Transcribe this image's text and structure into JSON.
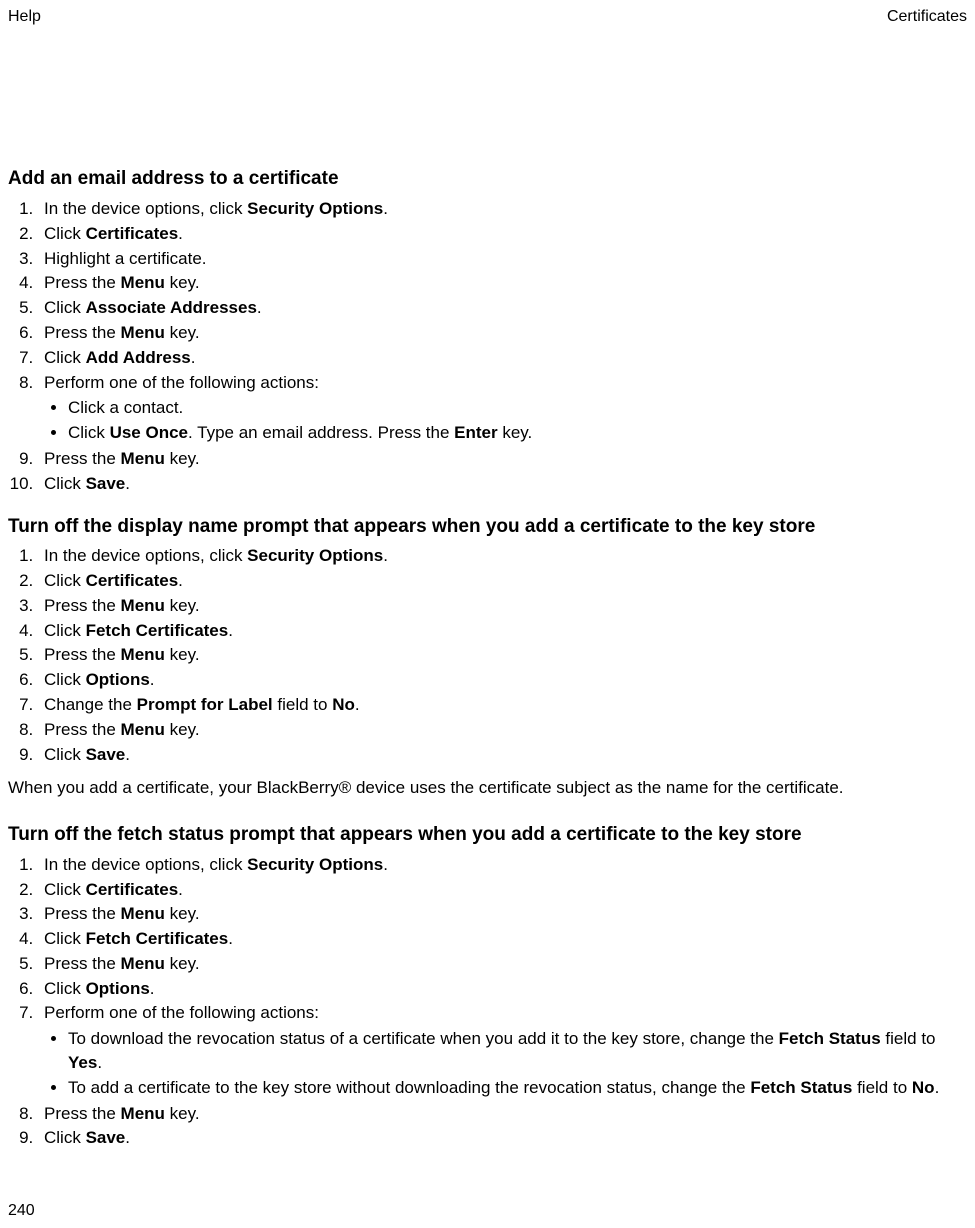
{
  "header": {
    "left": "Help",
    "right": "Certificates"
  },
  "footer": {
    "page": "240"
  },
  "sections": [
    {
      "title": "Add an email address to a certificate",
      "steps": [
        {
          "pre": "In the device options, click ",
          "bold": "Security Options",
          "post": "."
        },
        {
          "pre": "Click ",
          "bold": "Certificates",
          "post": "."
        },
        {
          "pre": "Highlight a certificate."
        },
        {
          "pre": "Press the ",
          "bold": "Menu",
          "post": " key."
        },
        {
          "pre": "Click ",
          "bold": "Associate Addresses",
          "post": "."
        },
        {
          "pre": "Press the ",
          "bold": "Menu",
          "post": " key."
        },
        {
          "pre": "Click ",
          "bold": "Add Address",
          "post": "."
        },
        {
          "pre": "Perform one of the following actions:",
          "sub": [
            {
              "pre": "Click a contact."
            },
            {
              "pre": "Click ",
              "bold": "Use Once",
              "post1": ". Type an email address. Press the ",
              "bold2": "Enter",
              "post2": " key."
            }
          ]
        },
        {
          "pre": "Press the ",
          "bold": "Menu",
          "post": " key."
        },
        {
          "pre": "Click ",
          "bold": "Save",
          "post": "."
        }
      ]
    },
    {
      "title": "Turn off the display name prompt that appears when you add a certificate to the key store",
      "steps": [
        {
          "pre": "In the device options, click ",
          "bold": "Security Options",
          "post": "."
        },
        {
          "pre": "Click ",
          "bold": "Certificates",
          "post": "."
        },
        {
          "pre": "Press the ",
          "bold": "Menu",
          "post": " key."
        },
        {
          "pre": "Click ",
          "bold": "Fetch Certificates",
          "post": "."
        },
        {
          "pre": "Press the ",
          "bold": "Menu",
          "post": " key."
        },
        {
          "pre": "Click ",
          "bold": "Options",
          "post": "."
        },
        {
          "pre": "Change the ",
          "bold": "Prompt for Label",
          "post1": " field to ",
          "bold2": "No",
          "post2": "."
        },
        {
          "pre": "Press the ",
          "bold": "Menu",
          "post": " key."
        },
        {
          "pre": "Click ",
          "bold": "Save",
          "post": "."
        }
      ],
      "note": "When you add a certificate, your BlackBerry® device uses the certificate subject as the name for the certificate."
    },
    {
      "title": "Turn off the fetch status prompt that appears when you add a certificate to the key store",
      "steps": [
        {
          "pre": "In the device options, click ",
          "bold": "Security Options",
          "post": "."
        },
        {
          "pre": "Click ",
          "bold": "Certificates",
          "post": "."
        },
        {
          "pre": "Press the ",
          "bold": "Menu",
          "post": " key."
        },
        {
          "pre": "Click ",
          "bold": "Fetch Certificates",
          "post": "."
        },
        {
          "pre": "Press the ",
          "bold": "Menu",
          "post": " key."
        },
        {
          "pre": "Click ",
          "bold": "Options",
          "post": "."
        },
        {
          "pre": "Perform one of the following actions:",
          "sub": [
            {
              "pre": "To download the revocation status of a certificate when you add it to the key store, change the ",
              "bold": "Fetch Status",
              "post1": " field to ",
              "bold2": "Yes",
              "post2": "."
            },
            {
              "pre": "To add a certificate to the key store without downloading the revocation status, change the ",
              "bold": "Fetch Status",
              "post1": " field to ",
              "bold2": "No",
              "post2": "."
            }
          ]
        },
        {
          "pre": "Press the ",
          "bold": "Menu",
          "post": " key."
        },
        {
          "pre": "Click ",
          "bold": "Save",
          "post": "."
        }
      ]
    }
  ]
}
